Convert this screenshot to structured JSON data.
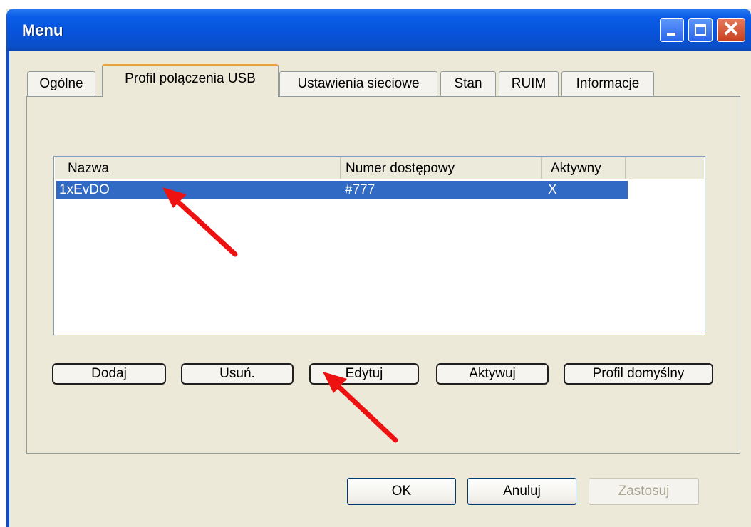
{
  "window": {
    "title": "Menu"
  },
  "tabs": [
    {
      "label": "Ogólne"
    },
    {
      "label": "Profil połączenia USB"
    },
    {
      "label": "Ustawienia sieciowe"
    },
    {
      "label": "Stan"
    },
    {
      "label": "RUIM"
    },
    {
      "label": "Informacje"
    }
  ],
  "active_tab": "Profil połączenia USB",
  "profile_list": {
    "columns": [
      "Nazwa",
      "Numer dostępowy",
      "Aktywny"
    ],
    "rows": [
      {
        "name": "1xEvDO",
        "number": "#777",
        "active": "X",
        "selected": true
      }
    ]
  },
  "profile_buttons": {
    "add": "Dodaj",
    "delete": "Usuń.",
    "edit": "Edytuj",
    "activate": "Aktywuj",
    "default_profile": "Profil domyślny"
  },
  "dialog_buttons": {
    "ok": "OK",
    "cancel": "Anuluj",
    "apply": "Zastosuj"
  },
  "colors": {
    "selection": "#316ac5",
    "annotation_arrow": "#ee1111",
    "title_bar": "#0a5ce8"
  }
}
